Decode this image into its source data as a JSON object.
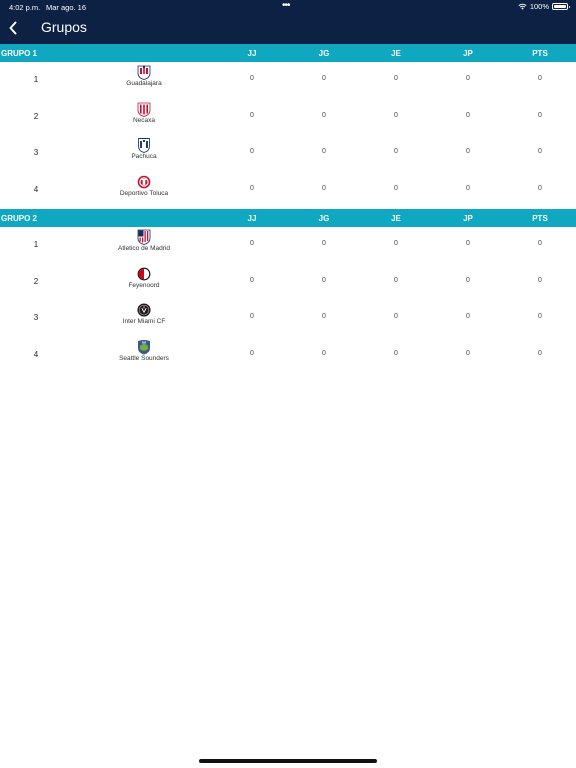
{
  "status_bar": {
    "time": "4:02 p.m.",
    "date": "Mar ago. 16",
    "dots": "•••",
    "battery": "100%"
  },
  "header": {
    "title": "Grupos"
  },
  "columns": [
    "JJ",
    "JG",
    "JE",
    "JP",
    "PTS"
  ],
  "groups": [
    {
      "name": "GRUPO 1",
      "teams": [
        {
          "pos": "1",
          "name": "Guadalajara",
          "logo": "guadalajara-logo",
          "stats": [
            "0",
            "0",
            "0",
            "0",
            "0"
          ]
        },
        {
          "pos": "2",
          "name": "Necaxa",
          "logo": "necaxa-logo",
          "stats": [
            "0",
            "0",
            "0",
            "0",
            "0"
          ]
        },
        {
          "pos": "3",
          "name": "Pachuca",
          "logo": "pachuca-logo",
          "stats": [
            "0",
            "0",
            "0",
            "0",
            "0"
          ]
        },
        {
          "pos": "4",
          "name": "Deportivo Toluca",
          "logo": "toluca-logo",
          "stats": [
            "0",
            "0",
            "0",
            "0",
            "0"
          ]
        }
      ]
    },
    {
      "name": "GRUPO 2",
      "teams": [
        {
          "pos": "1",
          "name": "Atletico de Madrid",
          "logo": "atletico-madrid-logo",
          "stats": [
            "0",
            "0",
            "0",
            "0",
            "0"
          ]
        },
        {
          "pos": "2",
          "name": "Feyenoord",
          "logo": "feyenoord-logo",
          "stats": [
            "0",
            "0",
            "0",
            "0",
            "0"
          ]
        },
        {
          "pos": "3",
          "name": "Inter Miami CF",
          "logo": "inter-miami-logo",
          "stats": [
            "0",
            "0",
            "0",
            "0",
            "0"
          ]
        },
        {
          "pos": "4",
          "name": "Seattle Sounders",
          "logo": "seattle-sounders-logo",
          "stats": [
            "0",
            "0",
            "0",
            "0",
            "0"
          ]
        }
      ]
    }
  ],
  "colors": {
    "header_bg": "#0c2144",
    "group_header_bg": "#0fa8c0",
    "background": "#ffffff"
  }
}
